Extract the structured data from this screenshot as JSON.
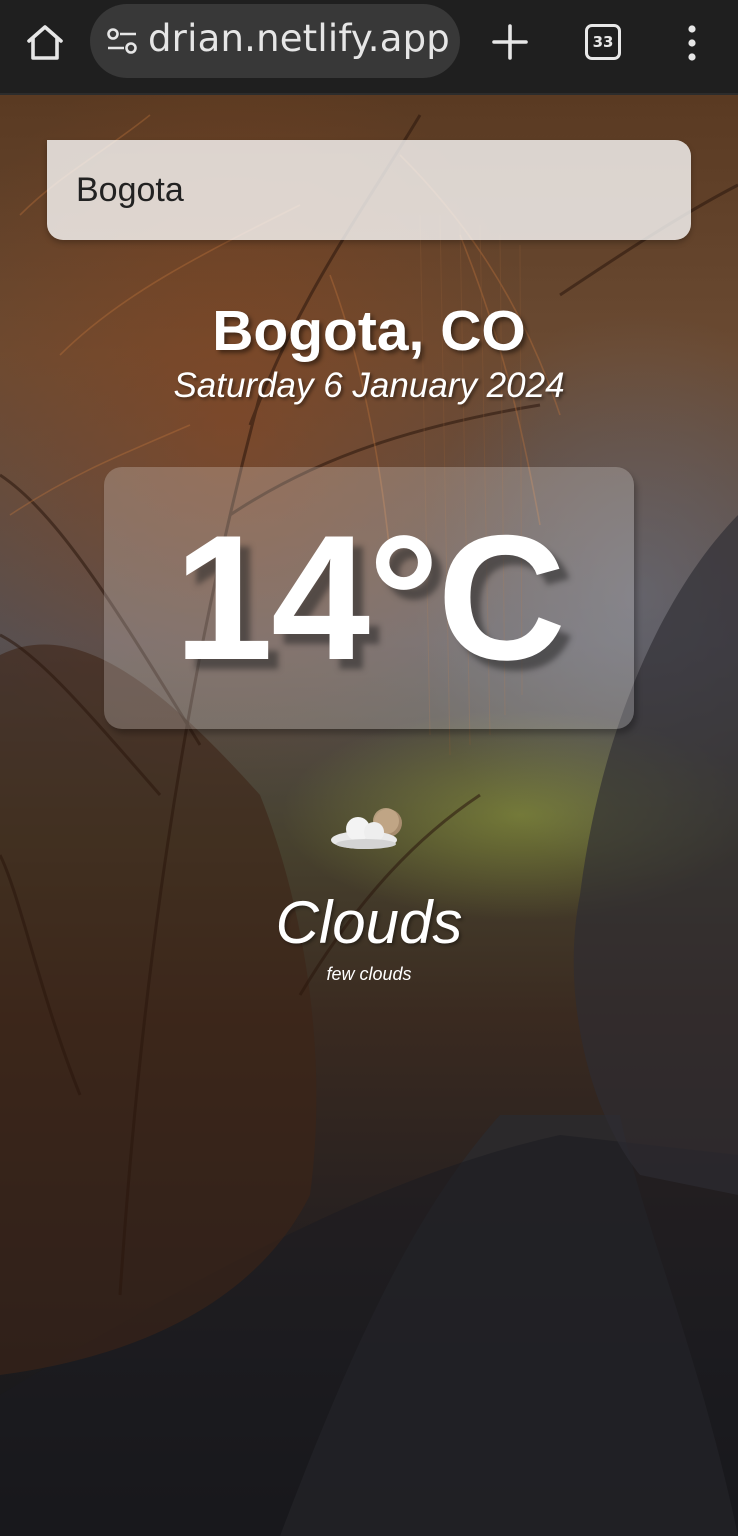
{
  "browser": {
    "url_text": "drian.netlify.app",
    "tab_count": "33",
    "icons": [
      "home-icon",
      "site-settings-icon",
      "new-tab-plus-icon",
      "tab-switcher-icon",
      "overflow-menu-icon"
    ]
  },
  "search": {
    "value": "Bogota"
  },
  "weather": {
    "location": "Bogota, CO",
    "date": "Saturday 6 January 2024",
    "temperature": "14°C",
    "condition": "Clouds",
    "description": "few clouds",
    "condition_icon": "few-clouds-icon"
  },
  "colors": {
    "chrome_bg": "#1f1f1f",
    "url_pill_bg": "#383838",
    "text": "#ffffff",
    "search_bg": "#ffffffc7"
  }
}
